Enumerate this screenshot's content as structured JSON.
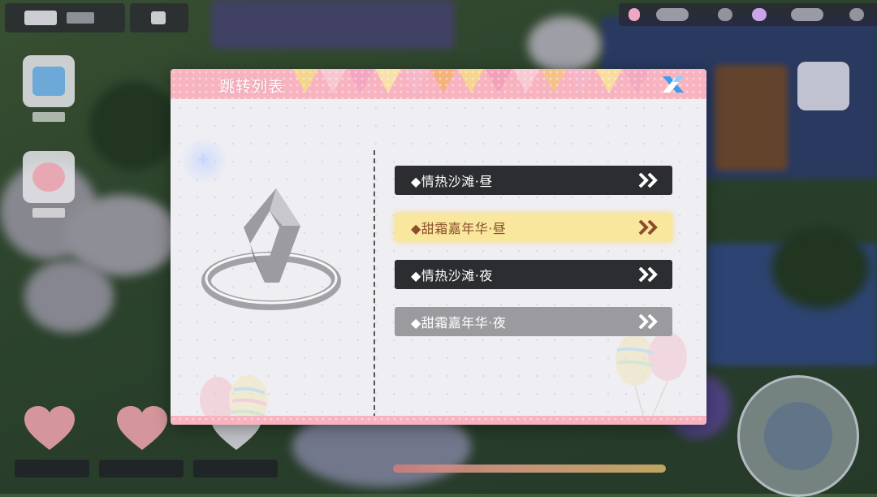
{
  "modal": {
    "title": "跳转列表",
    "close_icon": "close-x-icon",
    "destinations": [
      {
        "label": "◆情热沙滩·昼",
        "state": "normal"
      },
      {
        "label": "◆甜霜嘉年华·昼",
        "state": "selected"
      },
      {
        "label": "◆情热沙滩·夜",
        "state": "normal"
      },
      {
        "label": "◆甜霜嘉年华·夜",
        "state": "disabled"
      }
    ],
    "arrow_icon": "double-chevron-right-icon",
    "illustration_icon": "teleport-marker-icon"
  },
  "colors": {
    "header_pink": "#f7b3c0",
    "dark_button": "#2c2d31",
    "selected_button": "#f8e79d",
    "selected_text": "#8a4d2d",
    "disabled_button": "#9b9b9f",
    "close_blue": "#3a9fe8"
  }
}
